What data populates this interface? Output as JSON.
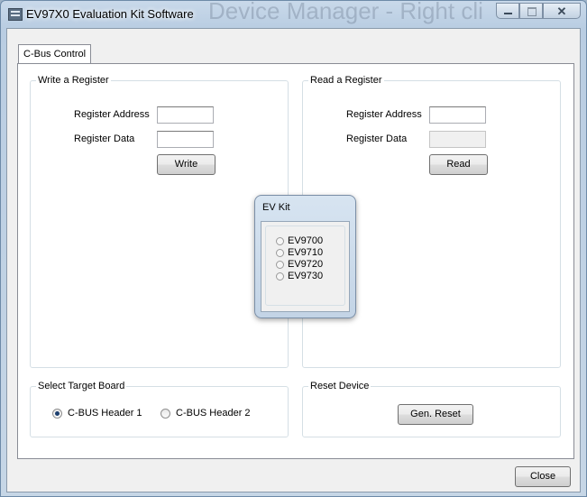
{
  "window": {
    "title": "EV97X0 Evaluation Kit Software",
    "background_text": "Device Manager  - Right cli"
  },
  "tabs": [
    {
      "label": "C-Bus Control"
    }
  ],
  "write_group": {
    "legend": "Write a Register",
    "address_label": "Register Address",
    "address_value": "",
    "data_label": "Register Data",
    "data_value": "",
    "button": "Write"
  },
  "read_group": {
    "legend": "Read a Register",
    "address_label": "Register Address",
    "address_value": "",
    "data_label": "Register Data",
    "data_value": "",
    "button": "Read"
  },
  "target_group": {
    "legend": "Select Target Board",
    "options": [
      {
        "label": "C-BUS Header 1",
        "selected": true
      },
      {
        "label": "C-BUS Header 2",
        "selected": false
      }
    ]
  },
  "reset_group": {
    "legend": "Reset Device",
    "button": "Gen. Reset"
  },
  "close_button": "Close",
  "ev_kit_popup": {
    "title": "EV Kit",
    "options": [
      "EV9700",
      "EV9710",
      "EV9720",
      "EV9730"
    ]
  },
  "icons": [
    "app-icon",
    "minimize-icon",
    "maximize-icon",
    "close-icon",
    "radio-selected-icon",
    "radio-unselected-icon"
  ],
  "colors": {
    "title_bar": "#c9d9ea",
    "client_bg": "#f0f0f0",
    "page_bg": "#ffffff",
    "accent": "#1b3e6e"
  }
}
